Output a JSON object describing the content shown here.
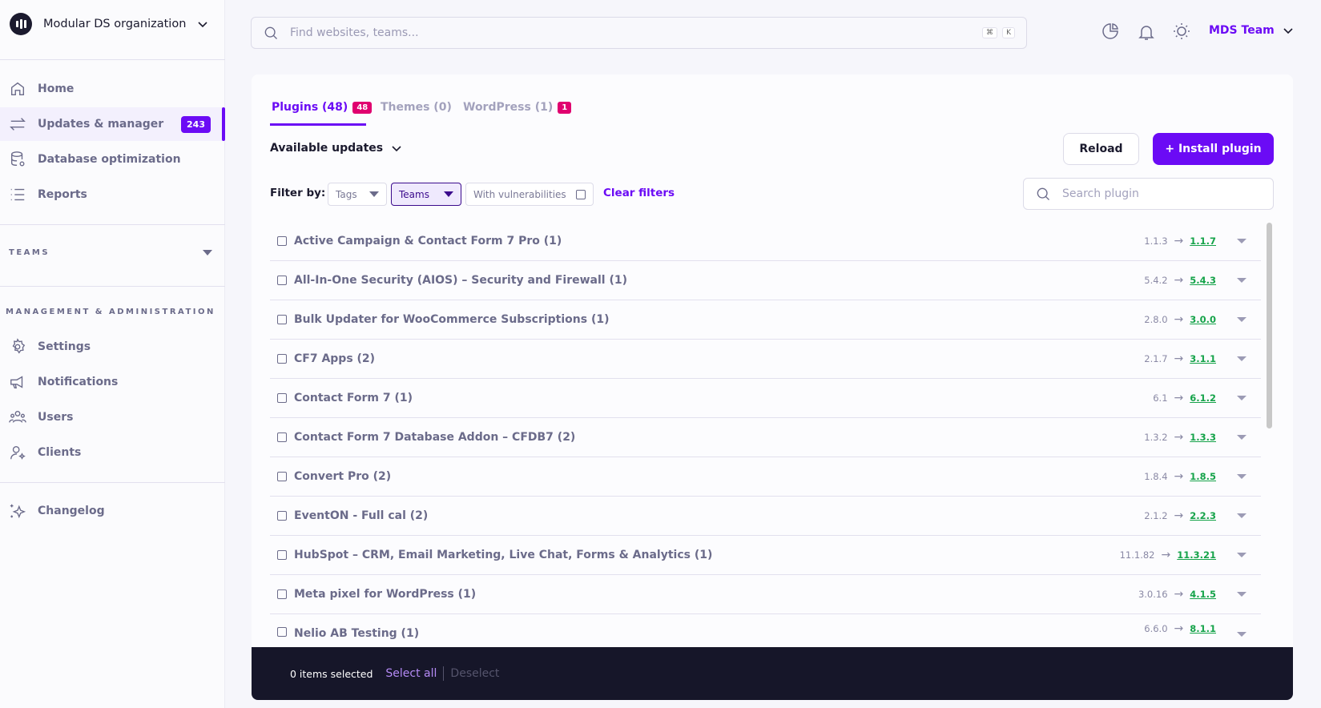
{
  "sidebar": {
    "org_name": "Modular DS organization",
    "nav": [
      {
        "label": "Home"
      },
      {
        "label": "Updates & manager",
        "badge": "243"
      },
      {
        "label": "Database optimization"
      },
      {
        "label": "Reports"
      }
    ],
    "teams_label": "TEAMS",
    "mgmt_label": "MANAGEMENT & ADMINISTRATION",
    "mgmt": [
      {
        "label": "Settings"
      },
      {
        "label": "Notifications"
      },
      {
        "label": "Users"
      },
      {
        "label": "Clients"
      }
    ],
    "changelog": "Changelog"
  },
  "header": {
    "search_placeholder": "Find websites, teams...",
    "kbd1": "⌘",
    "kbd2": "K",
    "team": "MDS Team"
  },
  "tabs": [
    {
      "label": "Plugins (48)",
      "badge": "48"
    },
    {
      "label": "Themes (0)"
    },
    {
      "label": "WordPress (1)",
      "badge": "1"
    }
  ],
  "view": "Available updates",
  "buttons": {
    "reload": "Reload",
    "install": "+ Install plugin"
  },
  "filters": {
    "label": "Filter by:",
    "tags": "Tags",
    "teams": "Teams",
    "vuln": "With vulnerabilities",
    "clear": "Clear filters",
    "search_placeholder": "Search plugin"
  },
  "plugins": [
    {
      "name": "Active Campaign & Contact Form 7 Pro (1)",
      "from": "1.1.3",
      "to": "1.1.7"
    },
    {
      "name": "All-In-One Security (AIOS) – Security and Firewall (1)",
      "from": "5.4.2",
      "to": "5.4.3"
    },
    {
      "name": "Bulk Updater for WooCommerce Subscriptions (1)",
      "from": "2.8.0",
      "to": "3.0.0"
    },
    {
      "name": "CF7 Apps (2)",
      "from": "2.1.7",
      "to": "3.1.1"
    },
    {
      "name": "Contact Form 7 (1)",
      "from": "6.1",
      "to": "6.1.2"
    },
    {
      "name": "Contact Form 7 Database Addon – CFDB7 (2)",
      "from": "1.3.2",
      "to": "1.3.3"
    },
    {
      "name": "Convert Pro (2)",
      "from": "1.8.4",
      "to": "1.8.5"
    },
    {
      "name": "EventON - Full cal (2)",
      "from": "2.1.2",
      "to": "2.2.3"
    },
    {
      "name": "HubSpot – CRM, Email Marketing, Live Chat, Forms & Analytics (1)",
      "from": "11.1.82",
      "to": "11.3.21"
    },
    {
      "name": "Meta pixel for WordPress (1)",
      "from": "3.0.16",
      "to": "4.1.5"
    },
    {
      "name": "Nelio AB Testing (1)",
      "from": "6.6.0",
      "to": "8.1.1"
    }
  ],
  "arrow": "→",
  "bottom": {
    "selected": "0 items selected",
    "select_all": "Select all",
    "deselect": "Deselect"
  }
}
